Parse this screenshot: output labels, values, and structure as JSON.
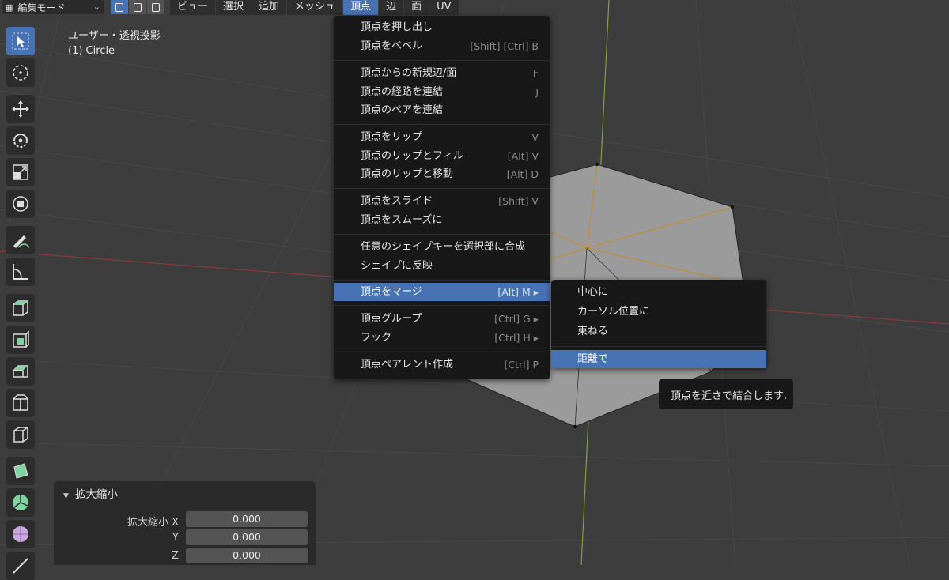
{
  "header": {
    "mode": "編集モード",
    "menus": [
      "ビュー",
      "選択",
      "追加",
      "メッシュ",
      "頂点",
      "辺",
      "面",
      "UV"
    ],
    "active_menu": "頂点"
  },
  "viewport": {
    "view_name": "ユーザー・透視投影",
    "object_name": "(1) Circle"
  },
  "toolbar": {
    "tools": [
      "select-box-icon",
      "cursor-icon",
      "move-icon",
      "rotate-icon",
      "scale-icon",
      "transform-icon",
      "annotate-icon",
      "measure-icon",
      "add-cube-icon",
      "extrude-region-icon",
      "inset-faces-icon",
      "bevel-icon",
      "loop-cut-icon",
      "knife-icon",
      "poly-build-icon",
      "spin-icon",
      "smooth-icon",
      "shrink-fatten-icon"
    ]
  },
  "vertex_menu": {
    "items": [
      {
        "label": "頂点を押し出し",
        "shortcut": ""
      },
      {
        "label": "頂点をベベル",
        "shortcut": "[Shift] [Ctrl] B"
      },
      {
        "label": "頂点からの新規辺/面",
        "shortcut": "F"
      },
      {
        "label": "頂点の経路を連結",
        "shortcut": "J"
      },
      {
        "label": "頂点のペアを連結",
        "shortcut": ""
      },
      {
        "label": "頂点をリップ",
        "shortcut": "V"
      },
      {
        "label": "頂点のリップとフィル",
        "shortcut": "[Alt] V"
      },
      {
        "label": "頂点のリップと移動",
        "shortcut": "[Alt] D"
      },
      {
        "label": "頂点をスライド",
        "shortcut": "[Shift] V"
      },
      {
        "label": "頂点をスムーズに",
        "shortcut": ""
      },
      {
        "label": "任意のシェイプキーを選択部に合成",
        "shortcut": ""
      },
      {
        "label": "シェイプに反映",
        "shortcut": ""
      },
      {
        "label": "頂点をマージ",
        "shortcut": "[Alt] M ▸"
      },
      {
        "label": "頂点グループ",
        "shortcut": "[Ctrl] G ▸"
      },
      {
        "label": "フック",
        "shortcut": "[Ctrl] H ▸"
      },
      {
        "label": "頂点ペアレント作成",
        "shortcut": "[Ctrl] P"
      }
    ]
  },
  "merge_menu": {
    "items": [
      "中心に",
      "カーソル位置に",
      "束ねる",
      "距離で"
    ],
    "highlighted": "距離で"
  },
  "tooltip": "頂点を近さで結合します.",
  "operator_panel": {
    "title": "拡大縮小",
    "fields": [
      {
        "label": "拡大縮小 X",
        "value": "0.000"
      },
      {
        "label": "Y",
        "value": "0.000"
      },
      {
        "label": "Z",
        "value": "0.000"
      }
    ]
  },
  "colors": {
    "accent": "#4772b3",
    "menu_bg": "#181818",
    "viewport_bg": "#3d3d3d"
  }
}
